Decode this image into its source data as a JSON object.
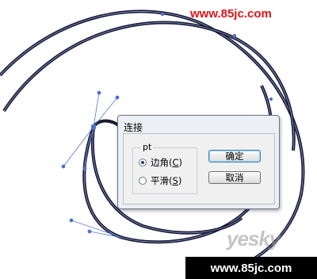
{
  "watermarks": {
    "top": "www.85jc.com",
    "bottom": "www.85jc.com",
    "logo": "yesky"
  },
  "dialog": {
    "title": "连接",
    "group_label": "pt",
    "options": [
      {
        "label": "边角(",
        "accel": "C",
        "suffix": ")",
        "checked": true
      },
      {
        "label": "平滑(",
        "accel": "S",
        "suffix": ")",
        "checked": false
      }
    ],
    "buttons": {
      "ok": "确定",
      "cancel": "取消"
    }
  },
  "colors": {
    "stroke": "#1a1a33",
    "handle": "#4a6fd0",
    "dialog_bg": "#ecf0f6"
  }
}
